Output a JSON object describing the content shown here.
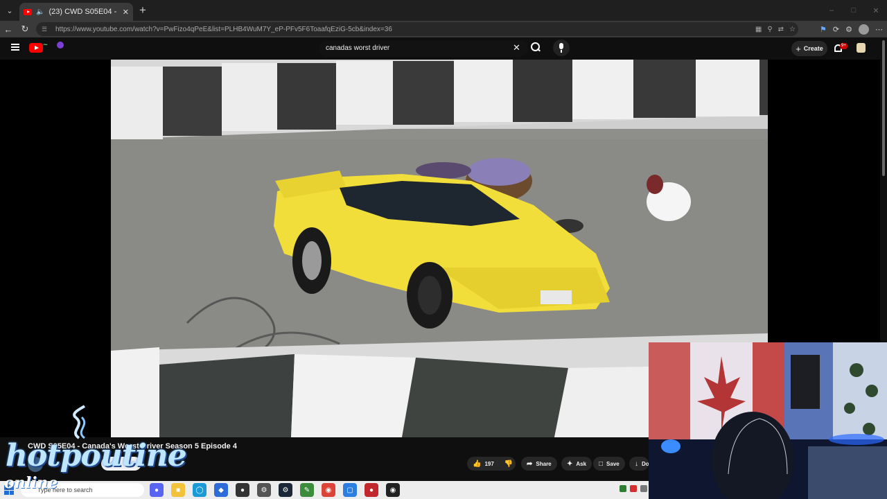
{
  "browser": {
    "tab_title": "(23) CWD S05E04 - Canada's",
    "url": "https://www.youtube.com/watch?v=PwFizo4qPeE&list=PLHB4WuM7Y_eP-PFv5F6ToaafqEziG-5cb&index=36"
  },
  "youtube": {
    "search_query": "canadas worst driver",
    "create_label": "Create",
    "notification_count": "9+"
  },
  "video": {
    "title": "CWD S05E04 - Canada's Worst Driver Season 5 Episode 4"
  },
  "actions": {
    "like_count": "197",
    "share_label": "Share",
    "ask_label": "Ask",
    "save_label": "Save",
    "download_label": "Download"
  },
  "taskbar": {
    "search_placeholder": "Type here to search"
  },
  "overlay": {
    "logo_text": "hotpoutine",
    "logo_sub": "online"
  },
  "colors": {
    "yt_red": "#ff0000",
    "background": "#0f0f0f",
    "car_yellow": "#f2de3a",
    "pill_bg": "#272727"
  }
}
